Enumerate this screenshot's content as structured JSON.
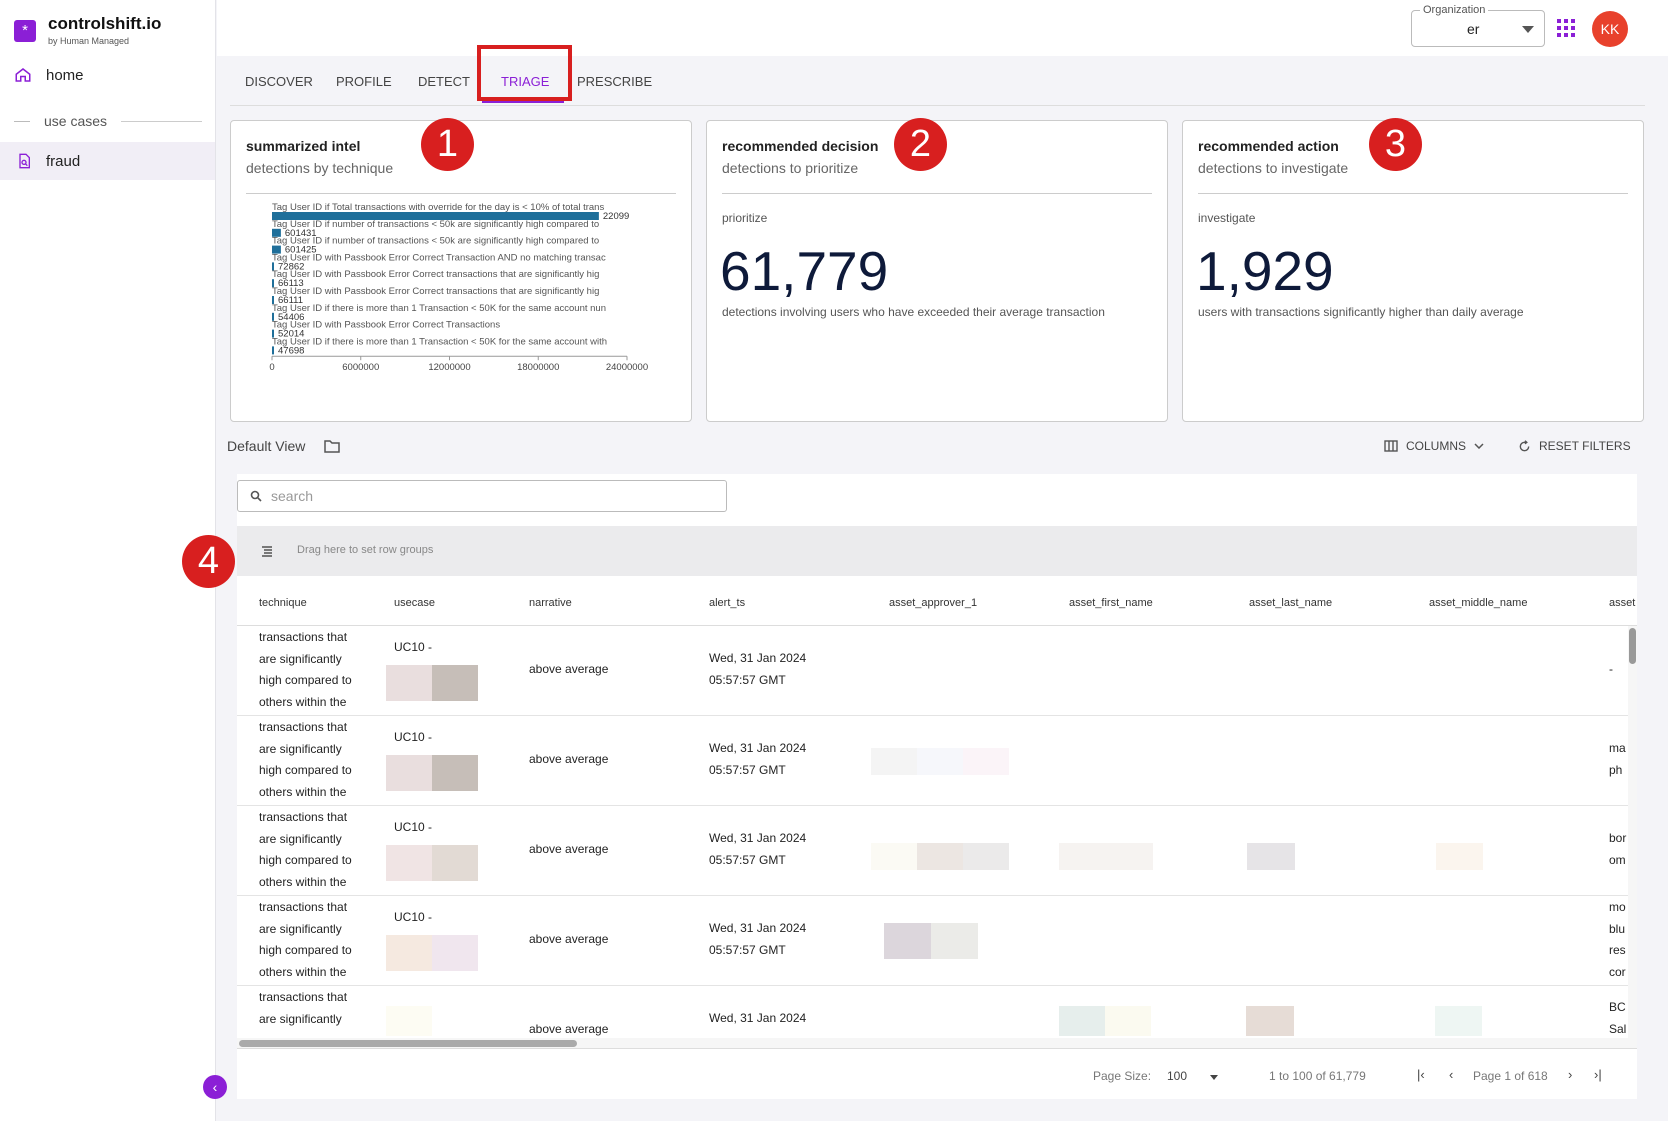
{
  "brand": {
    "name": "controlshift.io",
    "sub": "by Human Managed",
    "logo_glyph": "*",
    "accent": "#8b1fd6"
  },
  "sidebar": {
    "home_label": "home",
    "section_label": "use cases",
    "items": [
      {
        "label": "fraud",
        "icon": "document-search-icon"
      }
    ],
    "collapse_glyph": "‹"
  },
  "topbar": {
    "org_label": "Organization",
    "org_value": "er",
    "avatar_initials": "KK",
    "avatar_color": "#e8412c"
  },
  "tabs": [
    {
      "label": "DISCOVER",
      "active": false
    },
    {
      "label": "PROFILE",
      "active": false
    },
    {
      "label": "DETECT",
      "active": false
    },
    {
      "label": "TRIAGE",
      "active": true
    },
    {
      "label": "PRESCRIBE",
      "active": false
    }
  ],
  "badges": [
    "1",
    "2",
    "3",
    "4"
  ],
  "cards": {
    "intel": {
      "title": "summarized intel",
      "subtitle": "detections by technique"
    },
    "decision": {
      "title": "recommended decision",
      "subtitle": "detections to prioritize",
      "label": "prioritize",
      "value": "61,779",
      "description": "detections involving users who have exceeded their average transaction"
    },
    "action": {
      "title": "recommended action",
      "subtitle": "detections to investigate",
      "label": "investigate",
      "value": "1,929",
      "description": "users with transactions significantly higher than daily average"
    }
  },
  "chart_data": {
    "type": "bar",
    "orientation": "horizontal",
    "title": "",
    "xlabel": "",
    "ylabel": "",
    "xlim": [
      0,
      24000000
    ],
    "xticks": [
      "0",
      "6000000",
      "12000000",
      "18000000",
      "24000000"
    ],
    "categories": [
      "Tag User ID if Total transactions with override for the day is < 10% of total trans",
      "Tag User ID if number of transactions < 50k are significantly high compared to",
      "Tag User ID if number of transactions < 50k are significantly high compared to",
      "Tag User ID with Passbook Error Correct Transaction AND no matching transac",
      "Tag User ID with Passbook Error Correct transactions that are significantly hig",
      "Tag User ID with Passbook Error Correct transactions that are significantly hig",
      "Tag User ID if there is more than 1 Transaction < 50K for the same account nun",
      "Tag User ID with Passbook Error Correct Transactions",
      "Tag User ID if there is more than 1 Transaction < 50K for the same account with"
    ],
    "values": [
      22099000,
      601431,
      601425,
      72862,
      66113,
      66111,
      54406,
      52014,
      47698
    ],
    "value_labels": [
      "22099",
      "601431",
      "601425",
      "72862",
      "66113",
      "66111",
      "54406",
      "52014",
      "47698"
    ],
    "bar_color": "#1f6f9a"
  },
  "view": {
    "name": "Default View",
    "columns_label": "COLUMNS",
    "reset_label": "RESET FILTERS"
  },
  "grid": {
    "search_placeholder": "search",
    "group_hint": "Drag here to set row groups",
    "columns": [
      "technique",
      "usecase",
      "narrative",
      "alert_ts",
      "asset_approver_1",
      "asset_first_name",
      "asset_last_name",
      "asset_middle_name",
      "asset"
    ],
    "rows": [
      {
        "technique": [
          "transactions that",
          "are significantly",
          "high compared to",
          "others within the"
        ],
        "usecase": "UC10 -",
        "narrative": "above average",
        "alert_ts": [
          "Wed, 31 Jan 2024",
          "05:57:57 GMT"
        ],
        "asset": [
          "-"
        ]
      },
      {
        "technique": [
          "transactions that",
          "are significantly",
          "high compared to",
          "others within the"
        ],
        "usecase": "UC10 -",
        "narrative": "above average",
        "alert_ts": [
          "Wed, 31 Jan 2024",
          "05:57:57 GMT"
        ],
        "asset": [
          "ma",
          "ph"
        ]
      },
      {
        "technique": [
          "transactions that",
          "are significantly",
          "high compared to",
          "others within the"
        ],
        "usecase": "UC10 -",
        "narrative": "above average",
        "alert_ts": [
          "Wed, 31 Jan 2024",
          "05:57:57 GMT"
        ],
        "asset": [
          "bor",
          "om"
        ]
      },
      {
        "technique": [
          "transactions that",
          "are significantly",
          "high compared to",
          "others within the"
        ],
        "usecase": "UC10 -",
        "narrative": "above average",
        "alert_ts": [
          "Wed, 31 Jan 2024",
          "05:57:57 GMT"
        ],
        "asset": [
          "mo",
          "blu",
          "res",
          "cor"
        ]
      },
      {
        "technique": [
          "transactions that",
          "are significantly"
        ],
        "usecase": "",
        "narrative": "above average",
        "alert_ts": [
          "Wed, 31 Jan 2024"
        ],
        "asset": [
          "BC",
          "Sal"
        ]
      }
    ],
    "pager": {
      "page_size_label": "Page Size:",
      "page_size": "100",
      "range": "1 to 100 of 61,779",
      "page_info": "Page 1 of 618"
    }
  }
}
